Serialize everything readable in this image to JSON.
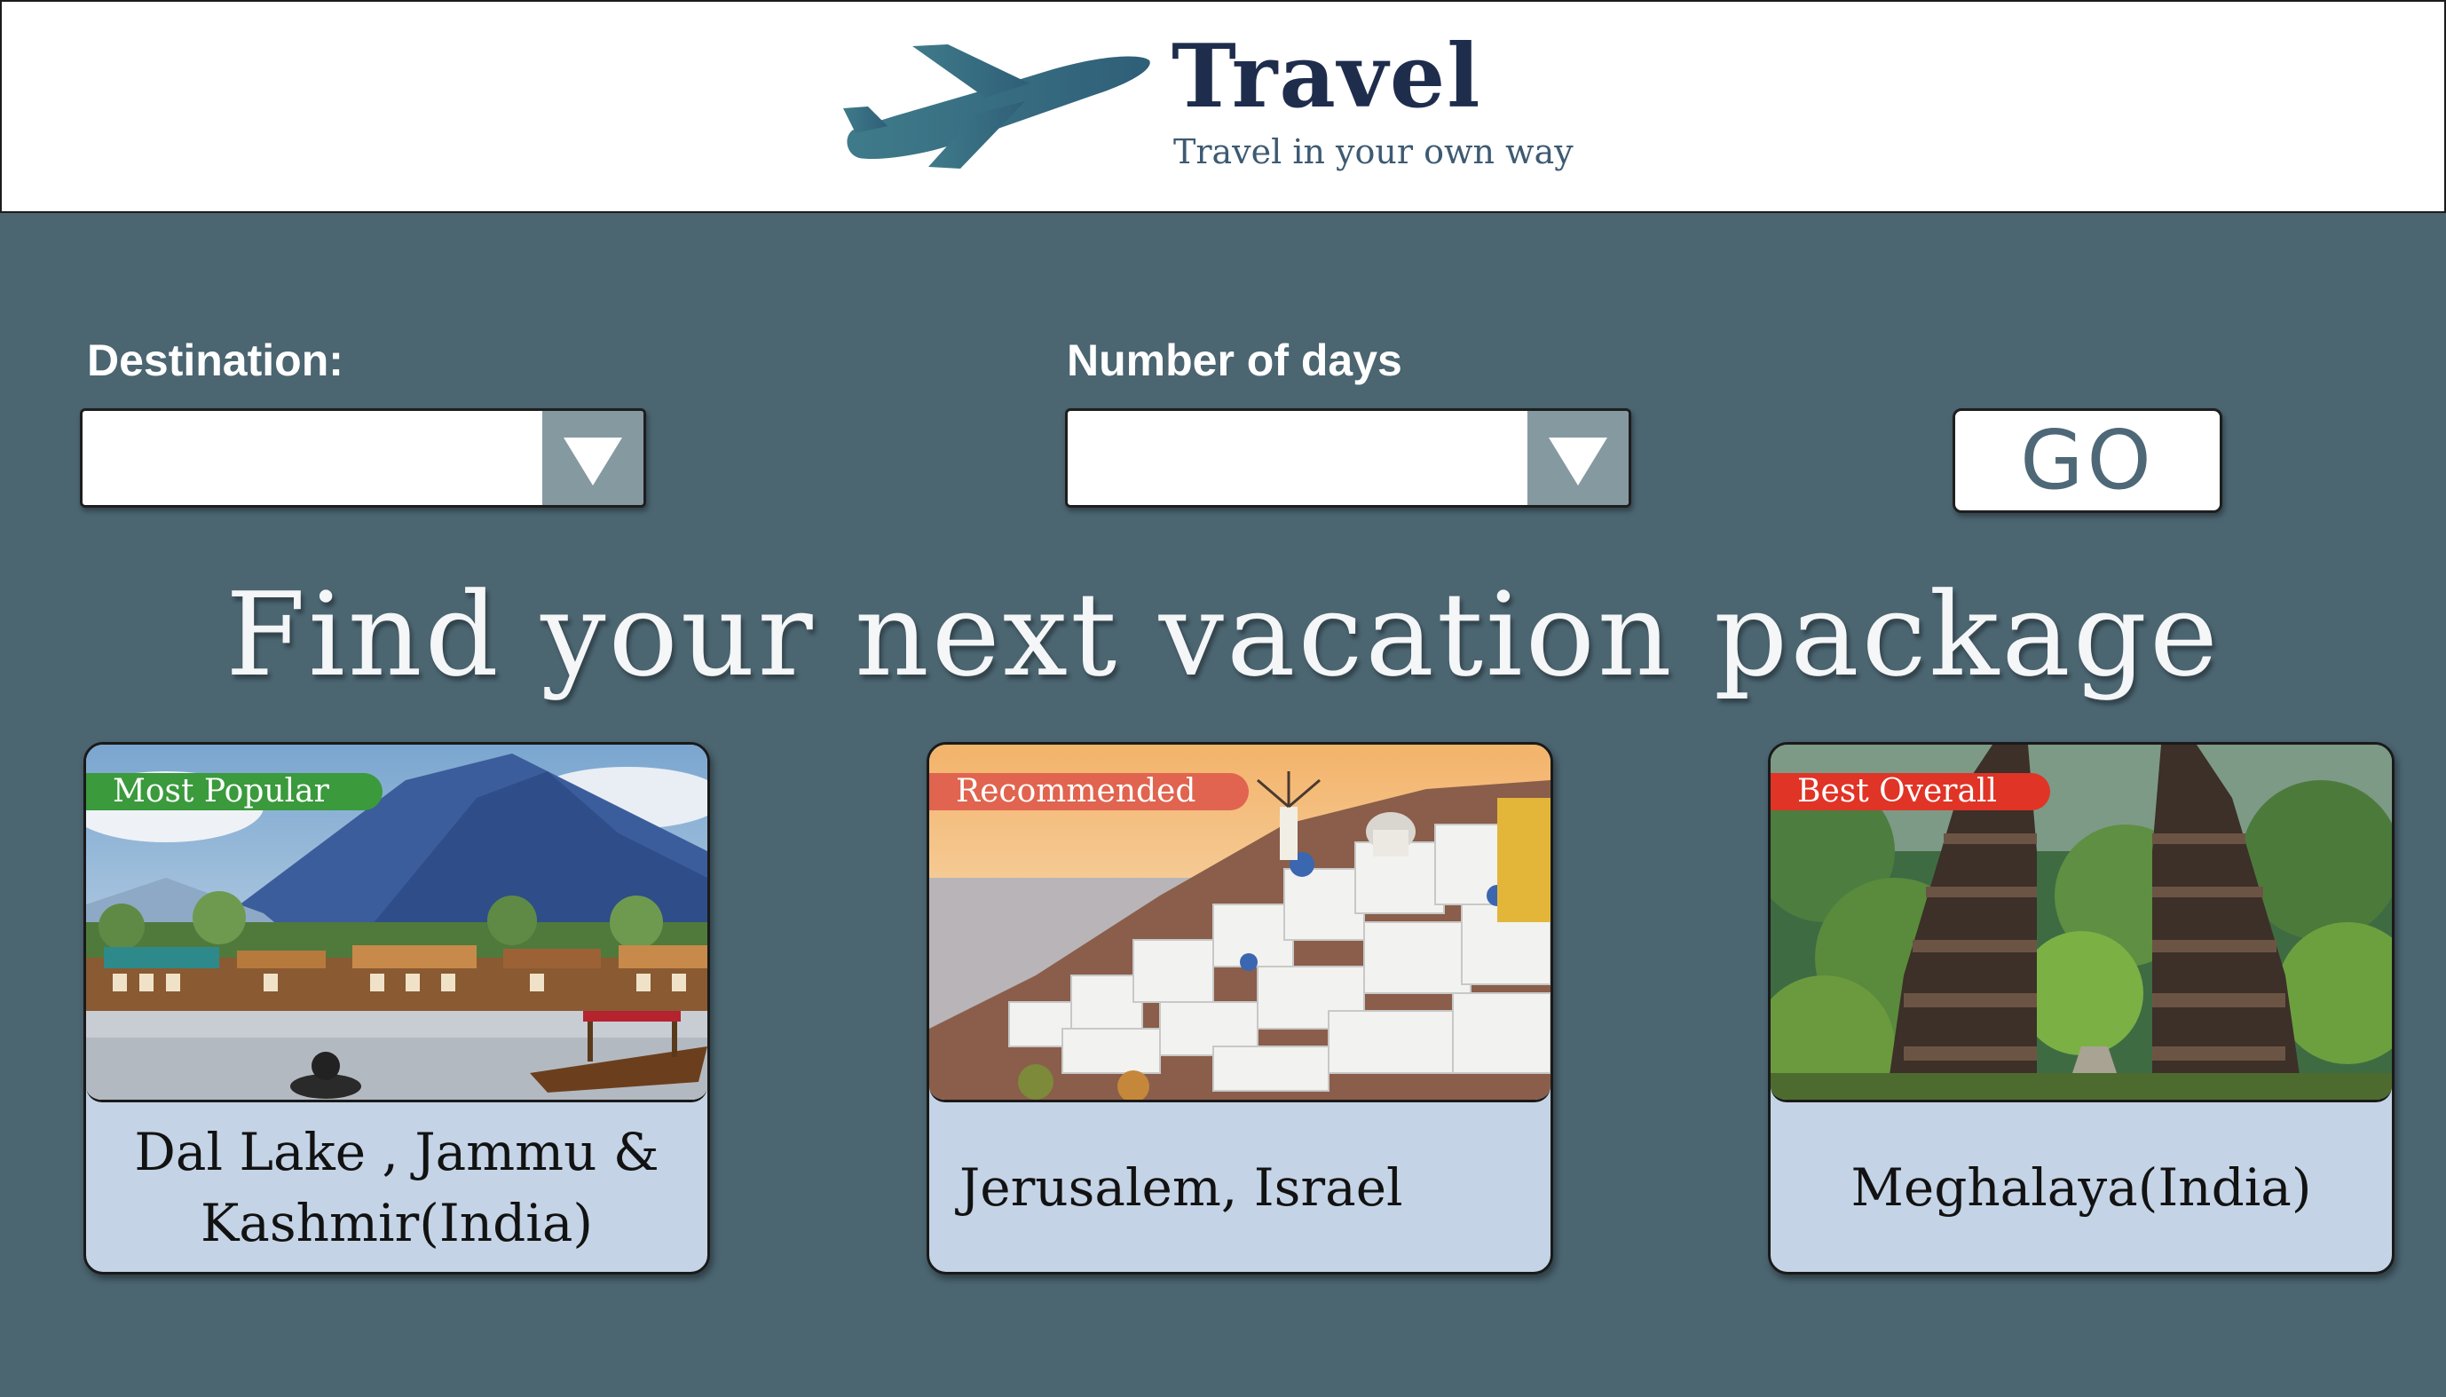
{
  "header": {
    "brand_title": "Travel",
    "brand_tagline": "Travel in your own way",
    "logo_icon": "airplane-icon"
  },
  "search": {
    "destination_label": "Destination:",
    "destination_value": "",
    "days_label": "Number of days",
    "days_value": "",
    "go_label": "GO"
  },
  "headline": "Find your next vacation package",
  "packages": [
    {
      "badge": "Most Popular",
      "badge_color": "#3a9a3c",
      "title": "Dal Lake , Jammu & Kashmir(India)"
    },
    {
      "badge": "Recommended",
      "badge_color": "#e0644f",
      "title": "Jerusalem, Israel"
    },
    {
      "badge": "Best Overall",
      "badge_color": "#e03427",
      "title": "Meghalaya(India)"
    }
  ],
  "colors": {
    "background": "#4b6571",
    "card": "#c4d3e5",
    "brand": "#1f2d4d",
    "arrow_box": "#8599a1"
  }
}
